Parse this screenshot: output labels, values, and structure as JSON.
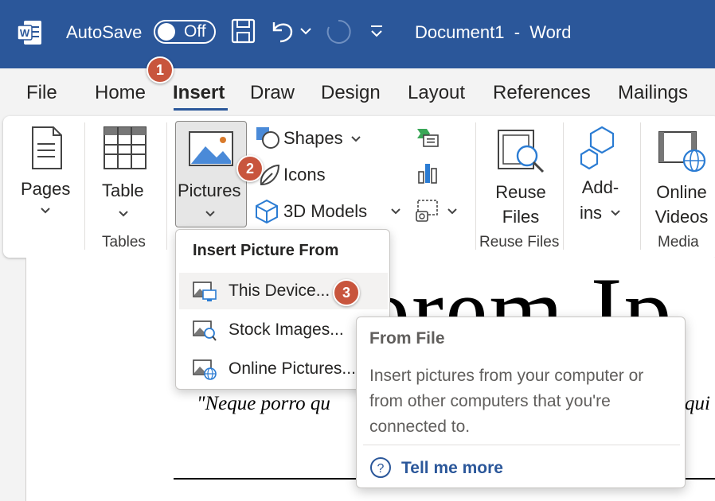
{
  "titlebar": {
    "autosave_label": "AutoSave",
    "autosave_state": "Off",
    "document_title": "Document1  -  Word",
    "icons": [
      "word-logo-icon",
      "save-icon",
      "undo-icon",
      "redo-icon",
      "customize-qat-icon"
    ]
  },
  "tabs": [
    "File",
    "Home",
    "Insert",
    "Draw",
    "Design",
    "Layout",
    "References",
    "Mailings"
  ],
  "active_tab": "Insert",
  "ribbon": {
    "pages": "Pages",
    "table": "Table",
    "tables_group": "Tables",
    "pictures": "Pictures",
    "shapes": "Shapes",
    "icons": "Icons",
    "models_3d": "3D Models",
    "reuse_files_line1": "Reuse",
    "reuse_files_line2": "Files",
    "reuse_files_group": "Reuse Files",
    "addins_line1": "Add-",
    "addins_line2": "ins",
    "online_videos_line1": "Online",
    "online_videos_line2": "Videos",
    "media_group": "Media"
  },
  "dropdown": {
    "header": "Insert Picture From",
    "items": [
      {
        "label": "This Device...",
        "icon": "device-picture-icon"
      },
      {
        "label": "Stock Images...",
        "icon": "stock-images-icon"
      },
      {
        "label": "Online Pictures...",
        "icon": "online-pictures-icon"
      }
    ]
  },
  "tooltip": {
    "title": "From File",
    "body": "Insert pictures from your computer or from other computers that you're connected to.",
    "link": "Tell me more"
  },
  "document": {
    "heading_fragment": "orem Ip",
    "quote_fragment": "\"Neque porro qu",
    "quote_right_fragment": "qui"
  },
  "badges": [
    "1",
    "2",
    "3"
  ],
  "colors": {
    "accent": "#2b579a",
    "badge": "#c8553d"
  }
}
